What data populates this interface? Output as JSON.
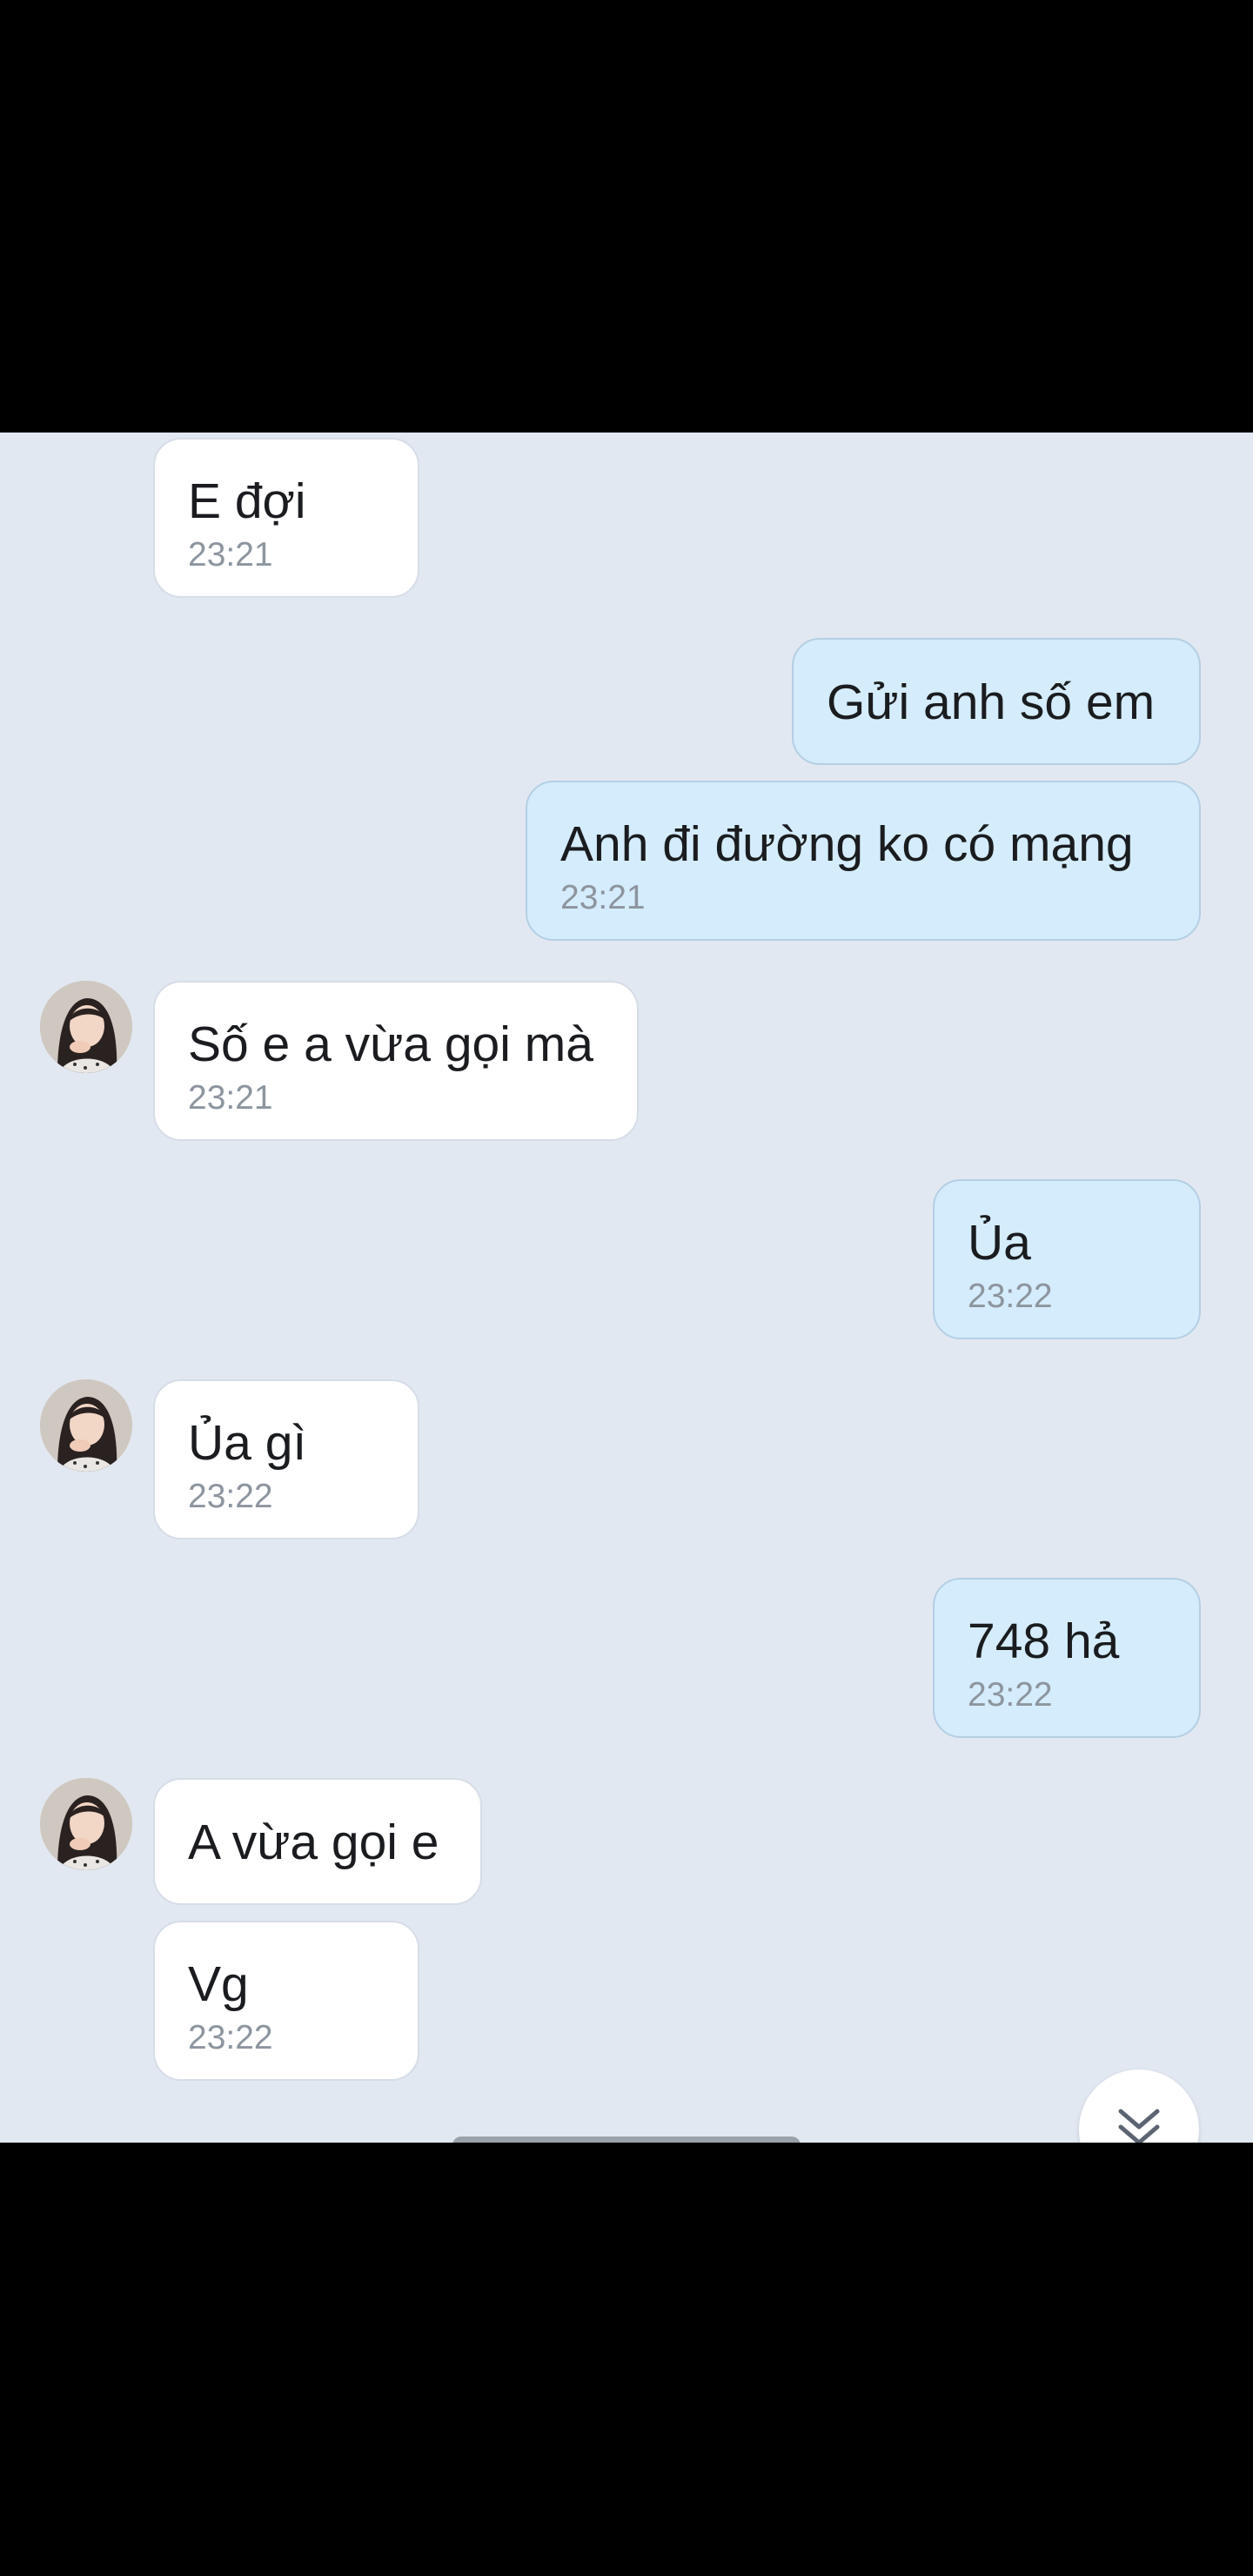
{
  "colors": {
    "chat_background": "#e2e8f1",
    "incoming_bubble": "#ffffff",
    "outgoing_bubble": "#d4ecfb",
    "timestamp": "#8d959f",
    "text": "#1a1c1f"
  },
  "messages": [
    {
      "direction": "incoming",
      "text": "E đợi",
      "time": "23:21",
      "avatar": false
    },
    {
      "direction": "outgoing",
      "text": "Gửi anh số em",
      "time": "",
      "avatar": false
    },
    {
      "direction": "outgoing",
      "text": "Anh đi đường ko có mạng",
      "time": "23:21",
      "avatar": false
    },
    {
      "direction": "incoming",
      "text": "Số e a vừa gọi mà",
      "time": "23:21",
      "avatar": true
    },
    {
      "direction": "outgoing",
      "text": "Ủa",
      "time": "23:22",
      "avatar": false
    },
    {
      "direction": "incoming",
      "text": "Ủa gì",
      "time": "23:22",
      "avatar": true
    },
    {
      "direction": "outgoing",
      "text": "748 hả",
      "time": "23:22",
      "avatar": false
    },
    {
      "direction": "incoming",
      "text": "A vừa gọi e",
      "time": "",
      "avatar": true
    },
    {
      "direction": "incoming",
      "text": "Vg",
      "time": "23:22",
      "avatar": false
    }
  ],
  "icons": {
    "avatar": "contact-avatar",
    "scroll_down": "chevron-double-down-icon"
  }
}
